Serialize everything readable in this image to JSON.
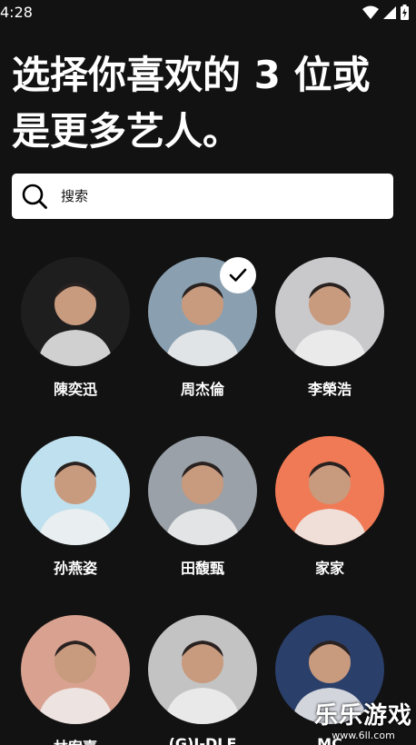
{
  "status_bar": {
    "time": "4:28",
    "icons": [
      "wifi-icon",
      "signal-icon",
      "battery-icon"
    ]
  },
  "title": "选择你喜欢的 3 位或是更多艺人。",
  "search": {
    "placeholder": "搜索",
    "value": ""
  },
  "artists": [
    {
      "name": "陳奕迅",
      "selected": false,
      "bg": "#1e1e1e"
    },
    {
      "name": "周杰倫",
      "selected": true,
      "bg": "#8aa0b0"
    },
    {
      "name": "李榮浩",
      "selected": false,
      "bg": "#c9c9cc"
    },
    {
      "name": "孙燕姿",
      "selected": false,
      "bg": "#bfe0ee"
    },
    {
      "name": "田馥甄",
      "selected": false,
      "bg": "#9aa1a8"
    },
    {
      "name": "家家",
      "selected": false,
      "bg": "#f07a55"
    },
    {
      "name": "林宥嘉",
      "selected": false,
      "bg": "#d9a290"
    },
    {
      "name": "(G)I-DLE",
      "selected": false,
      "bg": "#c3c3c3"
    },
    {
      "name": "MC",
      "selected": false,
      "bg": "#2a3f6a"
    }
  ],
  "watermark": {
    "text": "乐乐游戏",
    "url": "www.6ll.com"
  },
  "colors": {
    "background": "#121212",
    "search_bg": "#ffffff",
    "text": "#ffffff"
  }
}
